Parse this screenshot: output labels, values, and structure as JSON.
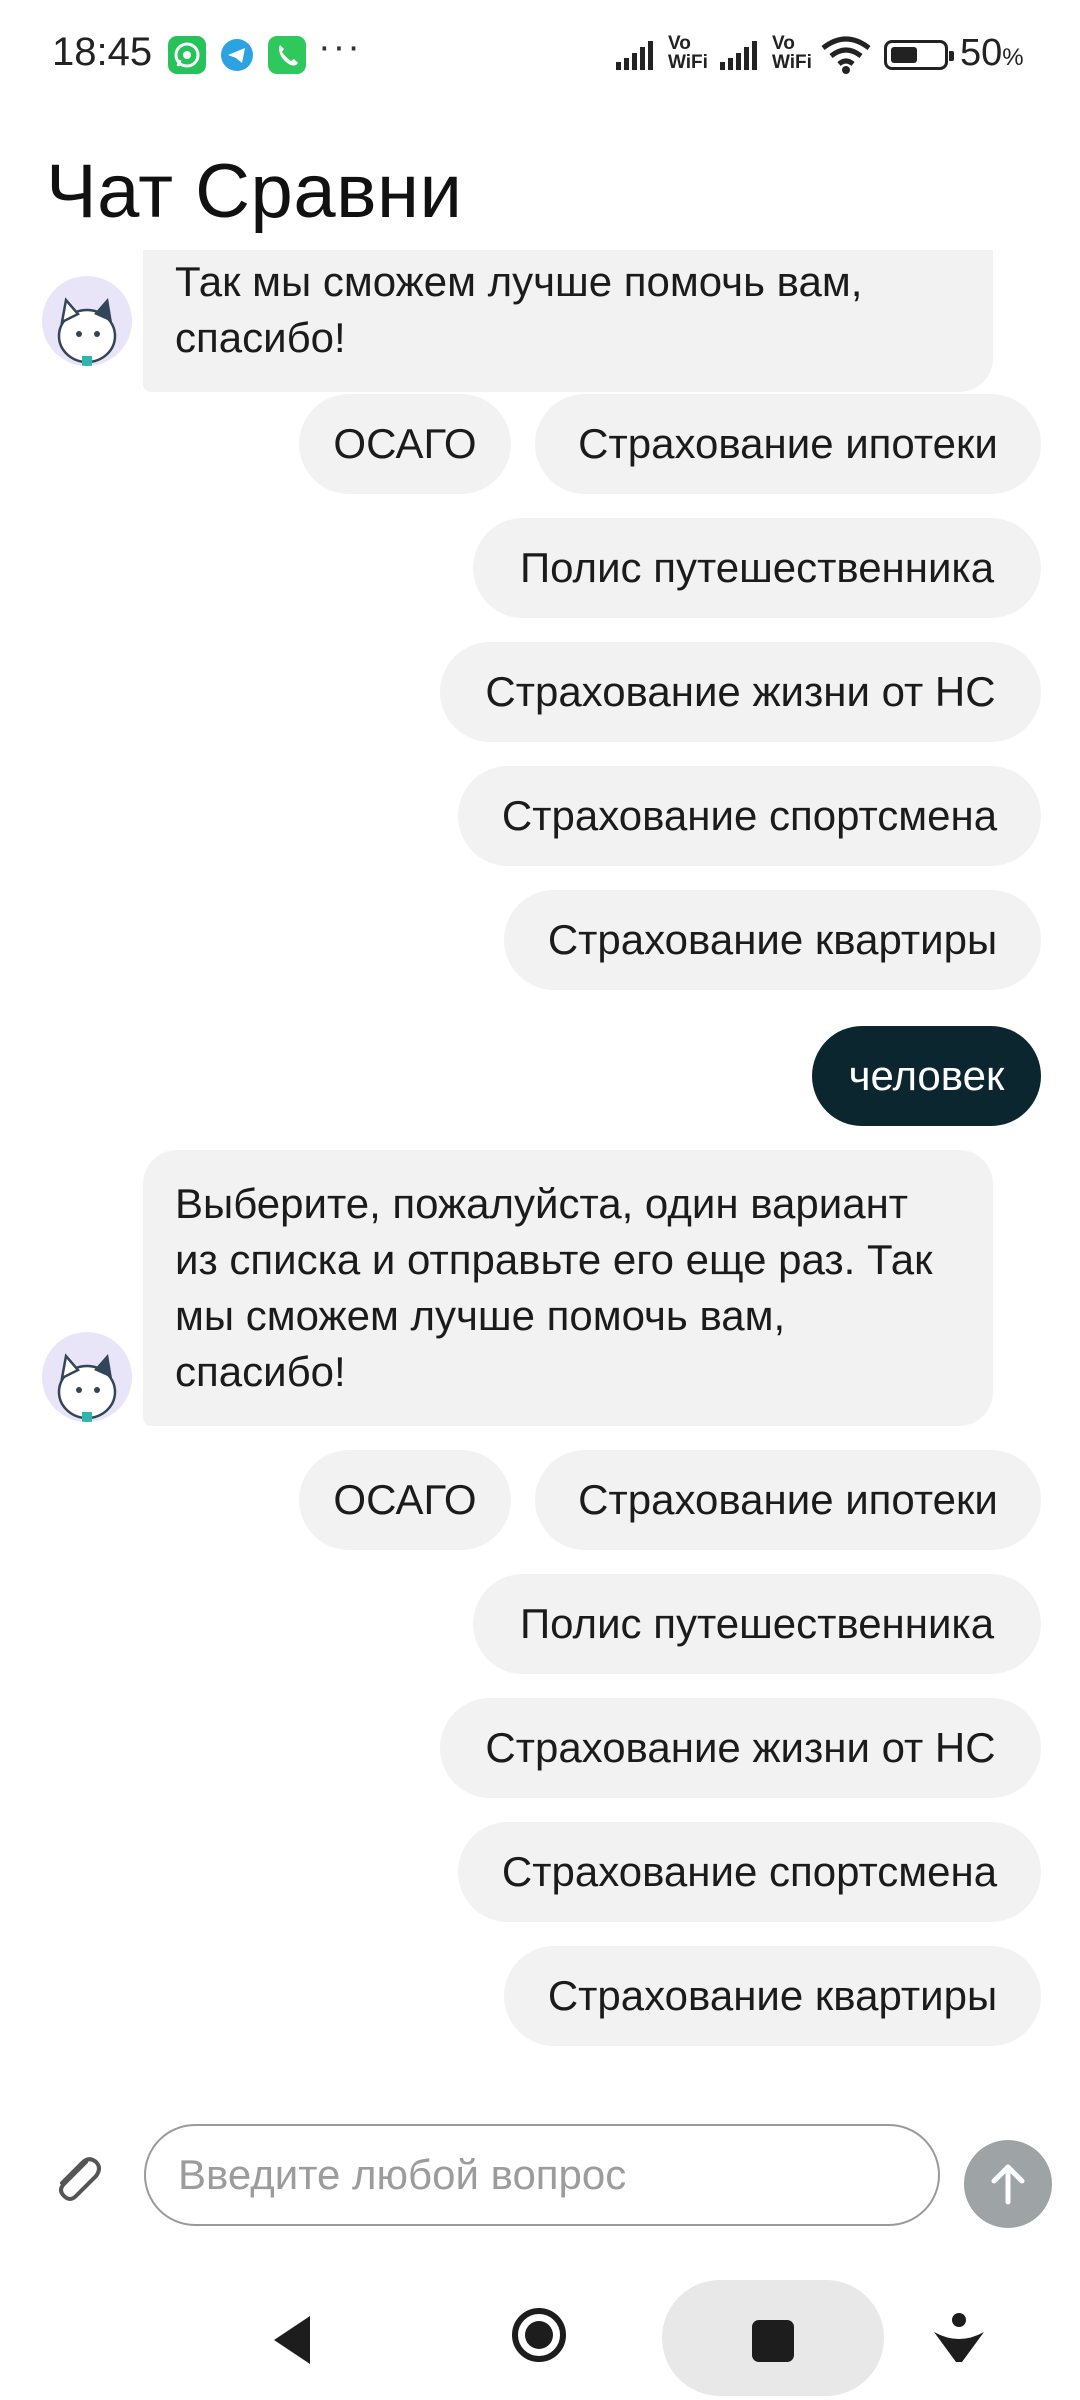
{
  "status_bar": {
    "time": "18:45",
    "more": "···",
    "vowifi_1": "Vo WiFi",
    "vowifi_2": "Vo WiFi",
    "battery_percent": "50",
    "battery_percent_sign": "%",
    "notification_icons": [
      "whatsapp-icon",
      "telegram-icon",
      "phone-icon"
    ]
  },
  "header": {
    "title": "Чат Сравни"
  },
  "chat": {
    "bot_message_1": "Так мы сможем лучше помочь вам, спасибо!",
    "options_1": [
      "ОСАГО",
      "Страхование ипотеки",
      "Полис путешественника",
      "Страхование жизни от НС",
      "Страхование спортсмена",
      "Страхование квартиры"
    ],
    "user_message": "человек",
    "bot_message_2": "Выберите, пожалуйста, один вариант из списка и отправьте его еще раз. Так мы сможем лучше помочь вам, спасибо!",
    "options_2": [
      "ОСАГО",
      "Страхование ипотеки",
      "Полис путешественника",
      "Страхование жизни от НС",
      "Страхование спортсмена",
      "Страхование квартиры"
    ]
  },
  "composer": {
    "placeholder": "Введите любой вопрос"
  },
  "colors": {
    "user_bubble": "#0c2630",
    "bot_bubble": "#f2f2f2",
    "send_button": "#9ea3a6"
  }
}
